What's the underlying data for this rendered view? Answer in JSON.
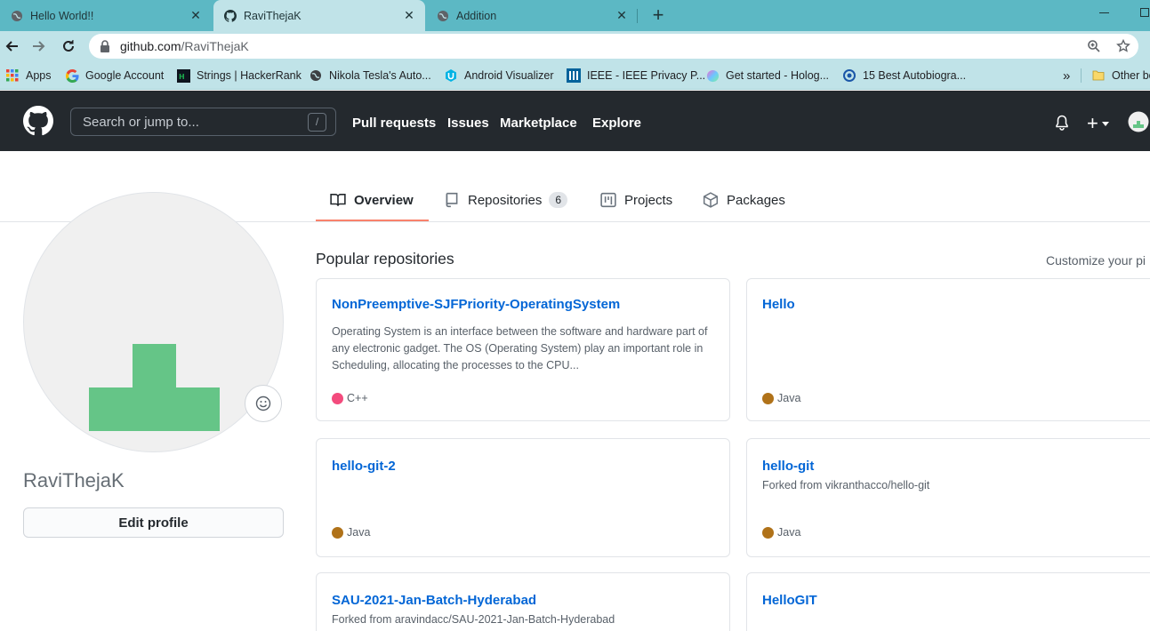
{
  "browser": {
    "tabs": [
      {
        "title": "Hello World!!",
        "active": false
      },
      {
        "title": "RaviThejaK",
        "active": true
      },
      {
        "title": "Addition",
        "active": false
      }
    ],
    "new_tab_symbol": "+",
    "address": {
      "domain": "github.com",
      "path": "/RaviThejaK"
    },
    "bookmarks": [
      {
        "label": "Apps",
        "icon": "apps-grid-icon"
      },
      {
        "label": "Google Account",
        "icon": "google-icon"
      },
      {
        "label": "Strings | HackerRank",
        "icon": "hackerrank-icon"
      },
      {
        "label": "Nikola Tesla's Auto...",
        "icon": "globe-icon"
      },
      {
        "label": "Android Visualizer",
        "icon": "udacity-icon"
      },
      {
        "label": "IEEE - IEEE Privacy P...",
        "icon": "ieee-icon"
      },
      {
        "label": "Get started - Holog...",
        "icon": "hologram-icon"
      },
      {
        "label": "15 Best Autobiogra...",
        "icon": "site-icon"
      }
    ],
    "bookmarks_overflow": "»",
    "other_bookmarks": "Other bo"
  },
  "github": {
    "search_placeholder": "Search or jump to...",
    "search_shortcut": "/",
    "nav": [
      "Pull requests",
      "Issues",
      "Marketplace",
      "Explore"
    ],
    "plus": "+"
  },
  "profile": {
    "username": "RaviThejaK",
    "edit_label": "Edit profile",
    "tabs": [
      {
        "label": "Overview",
        "icon": "book-icon"
      },
      {
        "label": "Repositories",
        "icon": "repo-icon",
        "count": "6"
      },
      {
        "label": "Projects",
        "icon": "project-icon"
      },
      {
        "label": "Packages",
        "icon": "package-icon"
      }
    ]
  },
  "repos_section": {
    "title": "Popular repositories",
    "customize": "Customize your pi",
    "repos": [
      {
        "name": "NonPreemptive-SJFPriority-OperatingSystem",
        "description": "Operating System is an interface between the software and hardware part of any electronic gadget. The OS (Operating System) play an important role in Scheduling, allocating the processes to the CPU...",
        "language": "C++",
        "lang_color": "#f34b7d"
      },
      {
        "name": "Hello",
        "language": "Java",
        "lang_color": "#b07219"
      },
      {
        "name": "hello-git-2",
        "language": "Java",
        "lang_color": "#b07219"
      },
      {
        "name": "hello-git",
        "forked": "Forked from vikranthacco/hello-git",
        "language": "Java",
        "lang_color": "#b07219"
      },
      {
        "name": "SAU-2021-Jan-Batch-Hyderabad",
        "forked": "Forked from aravindacc/SAU-2021-Jan-Batch-Hyderabad"
      },
      {
        "name": "HelloGIT"
      }
    ]
  },
  "colors": {
    "tabstrip": "#5cb8c4",
    "toolbar": "#c0e3e8",
    "gh_header": "#24292e",
    "link": "#0366d6",
    "tab_underline": "#f9826c",
    "identicon": "#65c587"
  }
}
